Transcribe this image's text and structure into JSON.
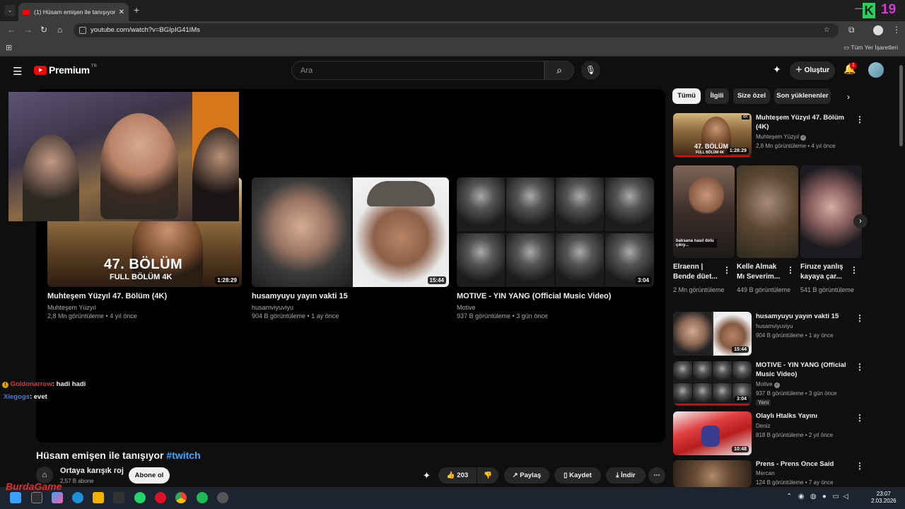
{
  "browser": {
    "tab_title": "(1) Hüsam emişen ile tanışıyor",
    "tab_close": "✕",
    "new_tab": "+",
    "url": "youtube.com/watch?v=BGIpIG41IMs",
    "bookmarks_all": "Tüm Yer İşaretleri",
    "overlay_letter": "K",
    "overlay_number": "19"
  },
  "header": {
    "logo_text": "Premium",
    "logo_region": "TR",
    "search_placeholder": "Ara",
    "create_label": "Oluştur",
    "notification_count": "1"
  },
  "player": {
    "endscreen": [
      {
        "title": "Muhteşem Yüzyıl 47. Bölüm (4K)",
        "channel": "Muhteşem Yüzyıl",
        "meta": "2,8 Mn görüntüleme • 4 yıl önce",
        "duration": "1:28:29",
        "thumb_text1": "47. BÖLÜM",
        "thumb_text2": "FULL BÖLÜM 4K"
      },
      {
        "title": "husamyuyu yayın vakti 15",
        "channel": "husamviyuviyu",
        "meta": "904 B görüntüleme • 1 ay önce",
        "duration": "15:44"
      },
      {
        "title": "MOTIVE - YIN YANG (Official Music Video)",
        "channel": "Motive",
        "meta": "937 B görüntüleme • 3 gün önce",
        "duration": "3:04"
      }
    ]
  },
  "chat": [
    {
      "user": "Goldonarrow",
      "text": ": hadi hadi",
      "color": "#e0343a"
    },
    {
      "user": "Xiegogs",
      "text": ": evet",
      "color": "#3d7be0"
    }
  ],
  "video": {
    "title": "Hüsam emişen ile tanışıyor",
    "hashtag": "#twitch",
    "channel_name": "Ortaya karışık roj",
    "subscribers": "2,57 B abone",
    "subscribe_label": "Abone ol",
    "likes": "203",
    "share_label": "Paylaş",
    "save_label": "Kaydet",
    "download_label": "İndir"
  },
  "sidebar": {
    "chips": [
      "Tümü",
      "İlgili",
      "Size özel",
      "Son yüklenenler"
    ],
    "first": {
      "title": "Muhteşem Yüzyıl 47. Bölüm (4K)",
      "channel": "Muhteşem Yüzyıl",
      "meta": "2,8 Mn görüntüleme • 4 yıl önce",
      "duration": "1:28:29",
      "thumb_text1": "47. BÖLÜM",
      "thumb_text2": "FULL BÖLÜM 4K",
      "badge": "4K"
    },
    "shorts": [
      {
        "title": "Elraenn | Bende düet...",
        "views": "2 Mn görüntüleme",
        "caption": "baksana nasıl dolu çıkıy..."
      },
      {
        "title": "Kelle Almak Mı Severim...",
        "views": "449 B görüntüleme"
      },
      {
        "title": "Firuze yanlış kayaya çar...",
        "views": "541 B görüntüleme"
      }
    ],
    "videos": [
      {
        "title": "husamyuyu yayın vakti 15",
        "channel": "husamviyuviyu",
        "meta": "904 B görüntüleme • 1 ay önce",
        "duration": "15:44"
      },
      {
        "title": "MOTIVE - YIN YANG (Official Music Video)",
        "channel": "Motive",
        "meta": "937 B görüntüleme • 3 gün önce",
        "duration": "3:04",
        "badge": "Yeni"
      },
      {
        "title": "Olaylı Htalks Yayını",
        "channel": "Deniz",
        "meta": "818 B görüntüleme • 2 yıl önce",
        "duration": "10:48"
      },
      {
        "title": "Prens - Prens Once Said",
        "channel": "Mercan",
        "meta": "124 B görüntüleme • 7 ay önce"
      }
    ]
  },
  "taskbar": {
    "time": "23:07",
    "date": "2.03.2026",
    "brand": "BurdaGame"
  }
}
